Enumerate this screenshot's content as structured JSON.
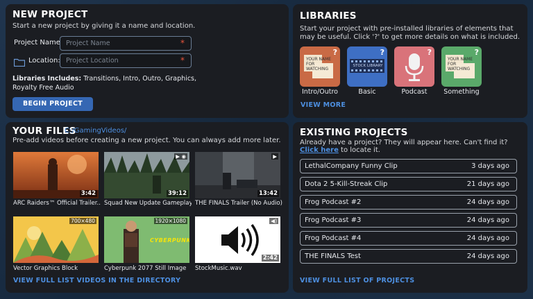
{
  "new_project": {
    "title": "NEW PROJECT",
    "subtitle": "Start a new project by giving it a name and location.",
    "name_label": "Project Name:",
    "name_placeholder": "Project Name",
    "location_label": "Location:",
    "location_placeholder": "Project Location",
    "required_mark": "*",
    "libraries_label": "Libraries Includes:",
    "libraries_value": "Transitions, Intro, Outro, Graphics, Royalty Free Audio",
    "begin_button": "BEGIN PROJECT"
  },
  "libraries": {
    "title": "LIBRARIES",
    "description": "Start your project with pre-installed libraries of elements that may be useful. Click '?' to get more details on what is included.",
    "items": [
      {
        "name": "Intro/Outro",
        "color": "#c96a45",
        "thumb_text": "YOUR NAME FOR WATCHING",
        "help": "?"
      },
      {
        "name": "Basic",
        "color": "#3e6fc4",
        "thumb_text": "STOCK LIBRARY",
        "help": "?"
      },
      {
        "name": "Podcast",
        "color": "#d9737a",
        "thumb_text": "",
        "help": "?"
      },
      {
        "name": "Something",
        "color": "#5aa96a",
        "thumb_text": "YOUR NAME FOR WATCHING",
        "help": "?"
      }
    ],
    "view_more": "VIEW MORE"
  },
  "files": {
    "title": "YOUR FILES",
    "path": "C:/GamingVideos/",
    "subtitle": "Pre-add videos before creating a new project. You can always add more later.",
    "items": [
      {
        "caption": "ARC Raiders™ Official Trailer...",
        "duration": "3:42",
        "badge": ""
      },
      {
        "caption": "Squad New Update Gameplay...",
        "duration": "39:12",
        "badge": ""
      },
      {
        "caption": "THE FINALS Trailer (No Audio)",
        "duration": "13:42",
        "badge": ""
      },
      {
        "caption": "Vector Graphics Block",
        "duration": "",
        "badge": "700×480"
      },
      {
        "caption": "Cyberpunk 2077 Still Image",
        "duration": "",
        "badge": "1920×1080",
        "logo_text": "CYBERPUNK"
      },
      {
        "caption": "StockMusic.wav",
        "duration": "2:42",
        "badge": ""
      }
    ],
    "view_full": "VIEW FULL LIST VIDEOS IN THE DIRECTORY"
  },
  "existing": {
    "title": "EXISTING PROJECTS",
    "line1": "Already have a project? They will appear here. Can't find it?",
    "click_here": "Click here",
    "line2_rest": " to locate it.",
    "projects": [
      {
        "name": "LethalCompany Funny Clip",
        "time": "3 days ago"
      },
      {
        "name": "Dota 2 5-Kill-Streak Clip",
        "time": "21 days ago"
      },
      {
        "name": "Frog Podcast #2",
        "time": "24 days ago"
      },
      {
        "name": "Frog Podcast #3",
        "time": "24 days ago"
      },
      {
        "name": "Frog Podcast #4",
        "time": "24 days ago"
      },
      {
        "name": "THE FINALS Test",
        "time": "24 days ago"
      }
    ],
    "view_full": "VIEW FULL LIST OF PROJECTS"
  }
}
